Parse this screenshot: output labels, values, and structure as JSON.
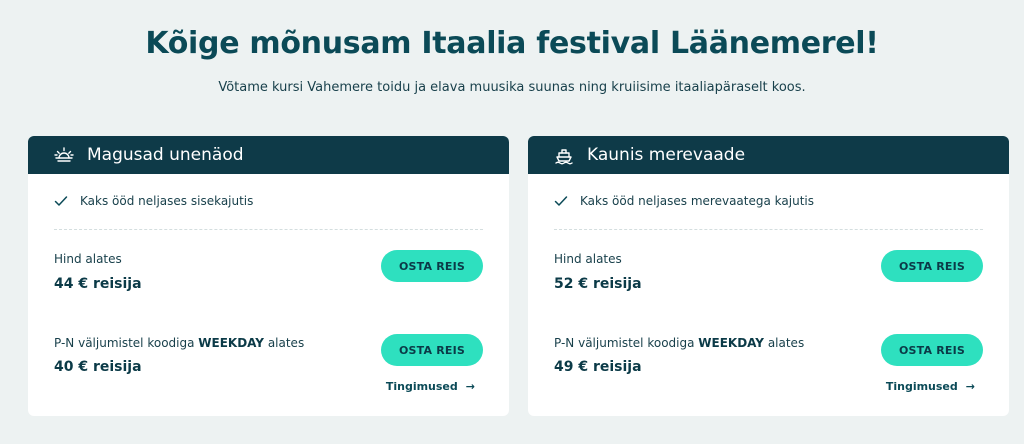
{
  "hero": {
    "title": "Kõige mõnusam Itaalia festival Läänemerel!",
    "subtitle": "Võtame kursi Vahemere toidu ja elava muusika suunas ning kruiisime itaaliapäraselt koos."
  },
  "colors": {
    "header_bg": "#0e3a48",
    "button_bg": "#2ee0bf",
    "page_bg": "#edf2f2"
  },
  "cards": [
    {
      "title": "Magusad unenäod",
      "icon": "sunrise-icon",
      "feature": "Kaks ööd neljases sisekajutis",
      "price_label": "Hind alates",
      "price": "44 € reisija",
      "promo_prefix": "P-N väljumistel koodiga ",
      "promo_code": "WEEKDAY",
      "promo_suffix": " alates",
      "promo_price": "40 € reisija",
      "button": "OSTA REIS",
      "terms": "Tingimused",
      "terms_arrow": "→"
    },
    {
      "title": "Kaunis merevaade",
      "icon": "ship-icon",
      "feature": "Kaks ööd neljases merevaatega kajutis",
      "price_label": "Hind alates",
      "price": "52 € reisija",
      "promo_prefix": "P-N väljumistel koodiga ",
      "promo_code": "WEEKDAY",
      "promo_suffix": " alates",
      "promo_price": "49 € reisija",
      "button": "OSTA REIS",
      "terms": "Tingimused",
      "terms_arrow": "→"
    }
  ]
}
